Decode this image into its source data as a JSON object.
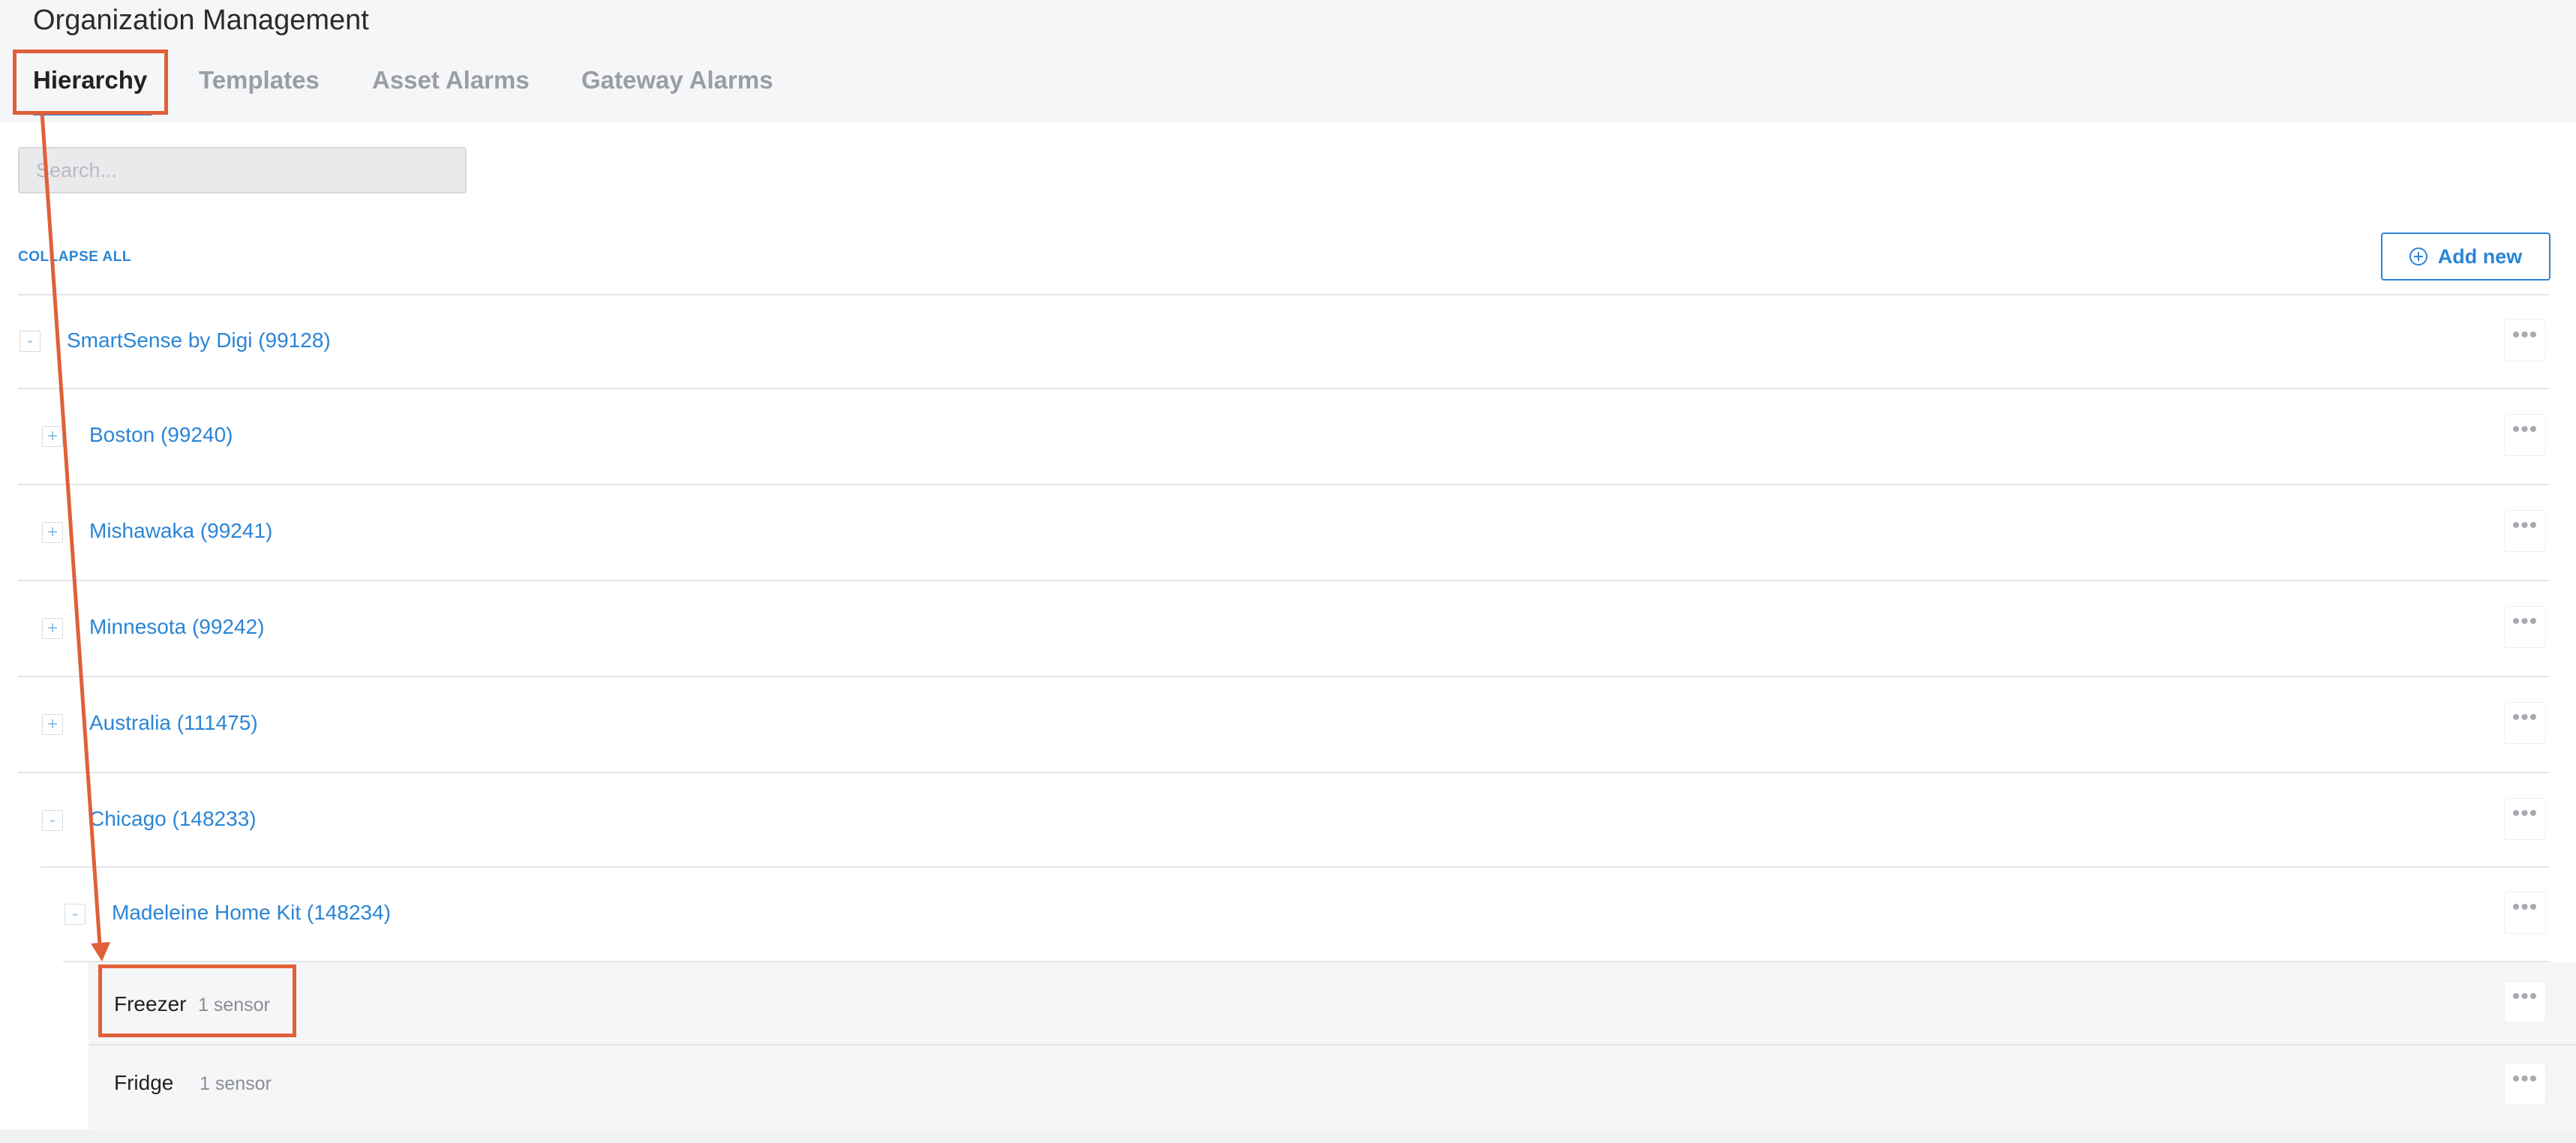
{
  "app": {
    "title": "Organization Management"
  },
  "tabs": [
    {
      "label": "Hierarchy",
      "active": true
    },
    {
      "label": "Templates",
      "active": false
    },
    {
      "label": "Asset Alarms",
      "active": false
    },
    {
      "label": "Gateway Alarms",
      "active": false
    }
  ],
  "search": {
    "placeholder": "Search..."
  },
  "toolbar": {
    "collapse_all": "COLLAPSE ALL",
    "add_new": "Add new"
  },
  "tree": {
    "nodes": [
      {
        "label": "SmartSense by Digi (99128)",
        "toggle": "-"
      },
      {
        "label": "Boston (99240)",
        "toggle": "+"
      },
      {
        "label": "Mishawaka (99241)",
        "toggle": "+"
      },
      {
        "label": "Minnesota (99242)",
        "toggle": "+"
      },
      {
        "label": "Australia (111475)",
        "toggle": "+"
      },
      {
        "label": "Chicago (148233)",
        "toggle": "-"
      },
      {
        "label": "Madeleine Home Kit (148234)",
        "toggle": "-"
      }
    ],
    "leaves": [
      {
        "name": "Freezer",
        "count": "1 sensor"
      },
      {
        "name": "Fridge",
        "count": "1 sensor"
      }
    ],
    "more_glyph": "•••"
  },
  "colors": {
    "accent": "#2a85d6",
    "annotation": "#e0603a",
    "text": "#222222",
    "muted": "#9a9ea4"
  }
}
